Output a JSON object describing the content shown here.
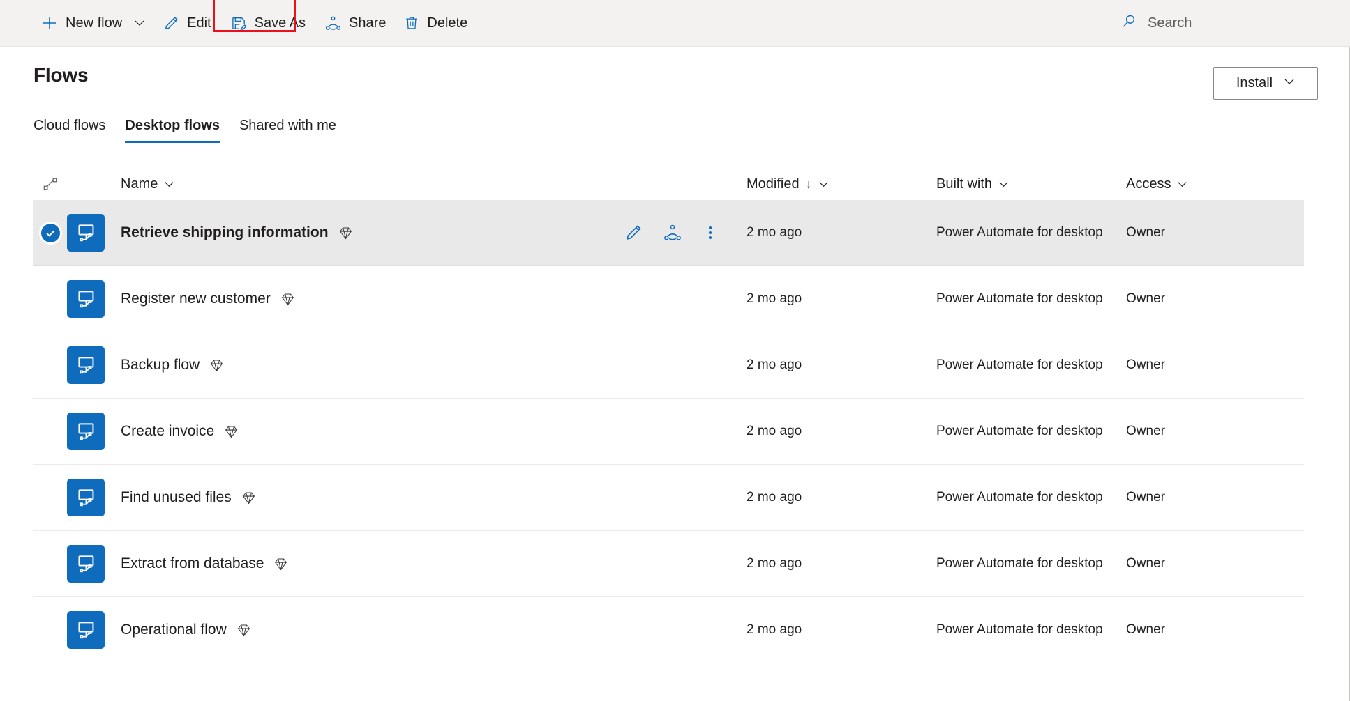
{
  "toolbar": {
    "new_flow": {
      "label": "New flow",
      "icon": "plus-icon",
      "caret": "chevron-down-icon"
    },
    "edit": {
      "label": "Edit",
      "icon": "pencil-icon"
    },
    "save_as": {
      "label": "Save As",
      "icon": "save-as-icon",
      "highlight_color": "#e8111c"
    },
    "share": {
      "label": "Share",
      "icon": "share-icon"
    },
    "delete": {
      "label": "Delete",
      "icon": "trash-icon"
    },
    "search": {
      "label": "Search",
      "placeholder": "Search",
      "icon": "search-icon"
    }
  },
  "header": {
    "title": "Flows",
    "install": {
      "label": "Install",
      "caret": "chevron-down-icon"
    }
  },
  "tabs": [
    {
      "label": "Cloud flows",
      "active": false
    },
    {
      "label": "Desktop flows",
      "active": true
    },
    {
      "label": "Shared with me",
      "active": false
    }
  ],
  "columns": {
    "grip_icon": "flow-grip-icon",
    "name": {
      "label": "Name",
      "caret": "chevron-down-icon"
    },
    "modified": {
      "label": "Modified",
      "sort": "↓",
      "caret": "chevron-down-icon"
    },
    "built_with": {
      "label": "Built with",
      "caret": "chevron-down-icon"
    },
    "access": {
      "label": "Access",
      "caret": "chevron-down-icon"
    }
  },
  "row_actions": {
    "edit_icon": "pencil-icon",
    "share_icon": "share-icon",
    "more_icon": "more-vertical-icon"
  },
  "rows": [
    {
      "selected": true,
      "name": "Retrieve shipping information",
      "premium": "premium-diamond-icon",
      "modified": "2 mo ago",
      "built_with": "Power Automate for desktop",
      "access": "Owner"
    },
    {
      "selected": false,
      "name": "Register new customer",
      "premium": "premium-diamond-icon",
      "modified": "2 mo ago",
      "built_with": "Power Automate for desktop",
      "access": "Owner"
    },
    {
      "selected": false,
      "name": "Backup flow",
      "premium": "premium-diamond-icon",
      "modified": "2 mo ago",
      "built_with": "Power Automate for desktop",
      "access": "Owner"
    },
    {
      "selected": false,
      "name": "Create invoice",
      "premium": "premium-diamond-icon",
      "modified": "2 mo ago",
      "built_with": "Power Automate for desktop",
      "access": "Owner"
    },
    {
      "selected": false,
      "name": "Find unused files",
      "premium": "premium-diamond-icon",
      "modified": "2 mo ago",
      "built_with": "Power Automate for desktop",
      "access": "Owner"
    },
    {
      "selected": false,
      "name": "Extract from database",
      "premium": "premium-diamond-icon",
      "modified": "2 mo ago",
      "built_with": "Power Automate for desktop",
      "access": "Owner"
    },
    {
      "selected": false,
      "name": "Operational flow",
      "premium": "premium-diamond-icon",
      "modified": "2 mo ago",
      "built_with": "Power Automate for desktop",
      "access": "Owner"
    }
  ],
  "colors": {
    "accent": "#0f6cbd",
    "command_bar_bg": "#f3f2f1",
    "selected_row_bg": "#e9e9e9",
    "highlight_box": "#e8111c",
    "text": "#201f1e"
  }
}
